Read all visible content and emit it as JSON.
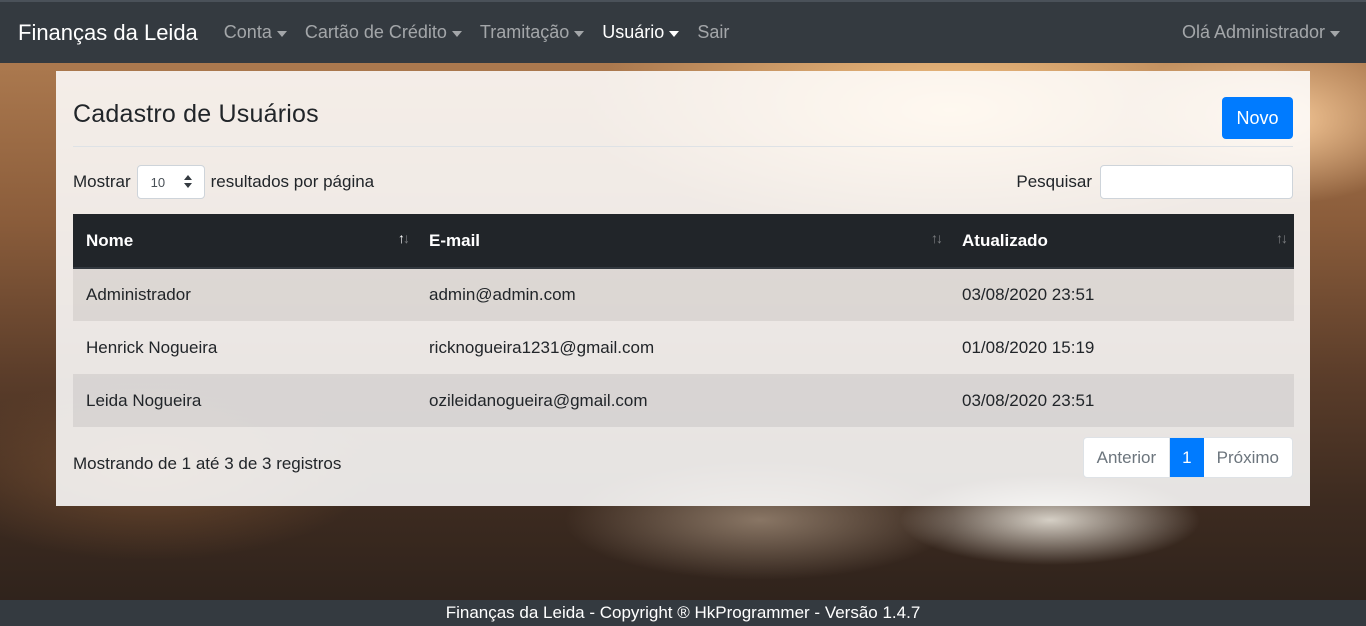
{
  "navbar": {
    "brand": "Finanças da Leida",
    "items": [
      {
        "label": "Conta",
        "dropdown": true
      },
      {
        "label": "Cartão de Crédito",
        "dropdown": true
      },
      {
        "label": "Tramitação",
        "dropdown": true
      },
      {
        "label": "Usuário",
        "dropdown": true,
        "active": true
      },
      {
        "label": "Sair",
        "dropdown": false
      }
    ],
    "user_menu": "Olá Administrador"
  },
  "page": {
    "title": "Cadastro de Usuários",
    "new_button": "Novo"
  },
  "table_controls": {
    "show_prefix": "Mostrar",
    "page_length": "10",
    "show_suffix": "resultados por página",
    "search_label": "Pesquisar",
    "search_value": ""
  },
  "table": {
    "columns": [
      "Nome",
      "E-mail",
      "Atualizado"
    ],
    "sorted_column": "Nome",
    "rows": [
      {
        "nome": "Administrador",
        "email": "admin@admin.com",
        "atualizado": "03/08/2020 23:51"
      },
      {
        "nome": "Henrick Nogueira",
        "email": "ricknogueira1231@gmail.com",
        "atualizado": "01/08/2020 15:19"
      },
      {
        "nome": "Leida Nogueira",
        "email": "ozileidanogueira@gmail.com",
        "atualizado": "03/08/2020 23:51"
      }
    ]
  },
  "footer_info": {
    "summary": "Mostrando de 1 até 3 de 3 registros",
    "pagination": {
      "previous": "Anterior",
      "current_page": "1",
      "next": "Próximo"
    }
  },
  "footer": {
    "text": "Finanças da Leida - Copyright ® HkProgrammer - Versão 1.4.7"
  },
  "colors": {
    "navbar": "#343a40",
    "primary": "#007bff",
    "table_header": "#212529"
  }
}
